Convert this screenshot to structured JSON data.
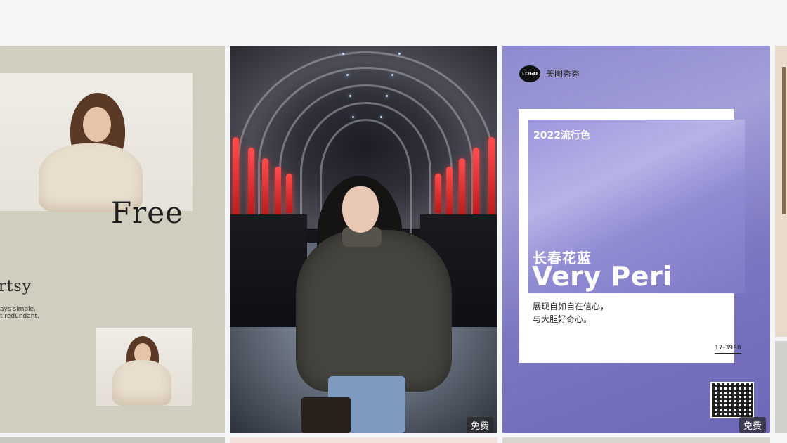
{
  "cards": [
    {
      "title": "Free",
      "subtitle": "rtsy",
      "tagline_1": "ays simple.",
      "tagline_2": "t redundant."
    },
    {
      "badge": "免费"
    },
    {
      "brand_logo": "LOGO",
      "brand_name": "美图秀秀",
      "year_label": "2022流行色",
      "color_name_cn": "长春花蓝",
      "color_name_en": "Very Peri",
      "desc_line_1": "展现自如自在信心，",
      "desc_line_2": "与大胆好奇心。",
      "color_code": "17-3938",
      "qr_icon": "qr-code-icon",
      "badge": "免费"
    }
  ],
  "colors": {
    "page_bg": "#f5f6f8",
    "very_peri": "#6667ab",
    "card1_bg": "#d0cfbf"
  }
}
